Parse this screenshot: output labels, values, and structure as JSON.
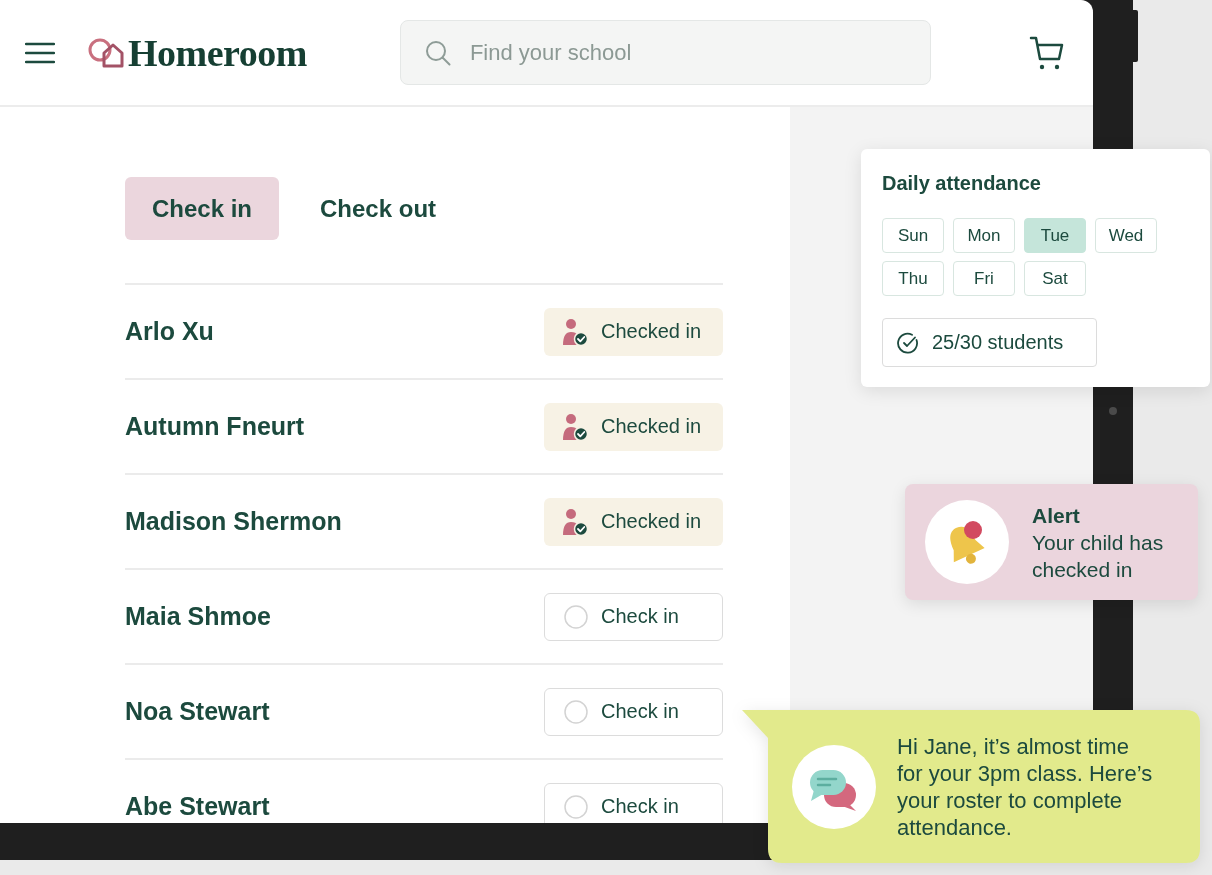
{
  "header": {
    "brand": "Homeroom",
    "search": {
      "placeholder": "Find your school"
    }
  },
  "tabs": [
    {
      "label": "Check in",
      "selected": true
    },
    {
      "label": "Check out",
      "selected": false
    }
  ],
  "students": [
    {
      "name": "Arlo Xu",
      "checked_in": true,
      "status": "Checked in"
    },
    {
      "name": "Autumn Fneurt",
      "checked_in": true,
      "status": "Checked in"
    },
    {
      "name": "Madison Shermon",
      "checked_in": true,
      "status": "Checked in"
    },
    {
      "name": "Maia Shmoe",
      "checked_in": false,
      "status": "Check in"
    },
    {
      "name": "Noa Stewart",
      "checked_in": false,
      "status": "Check in"
    },
    {
      "name": "Abe Stewart",
      "checked_in": false,
      "status": "Check in"
    }
  ],
  "attendance_card": {
    "title": "Daily attendance",
    "days": [
      {
        "label": "Sun",
        "selected": false
      },
      {
        "label": "Mon",
        "selected": false
      },
      {
        "label": "Tue",
        "selected": true
      },
      {
        "label": "Wed",
        "selected": false
      },
      {
        "label": "Thu",
        "selected": false
      },
      {
        "label": "Fri",
        "selected": false
      },
      {
        "label": "Sat",
        "selected": false
      }
    ],
    "summary": "25/30 students"
  },
  "alert": {
    "title": "Alert",
    "message": "Your child has checked in"
  },
  "message": {
    "text": "Hi Jane, it’s almost time for your 3pm class. Here’s your roster to complete attendance."
  }
}
